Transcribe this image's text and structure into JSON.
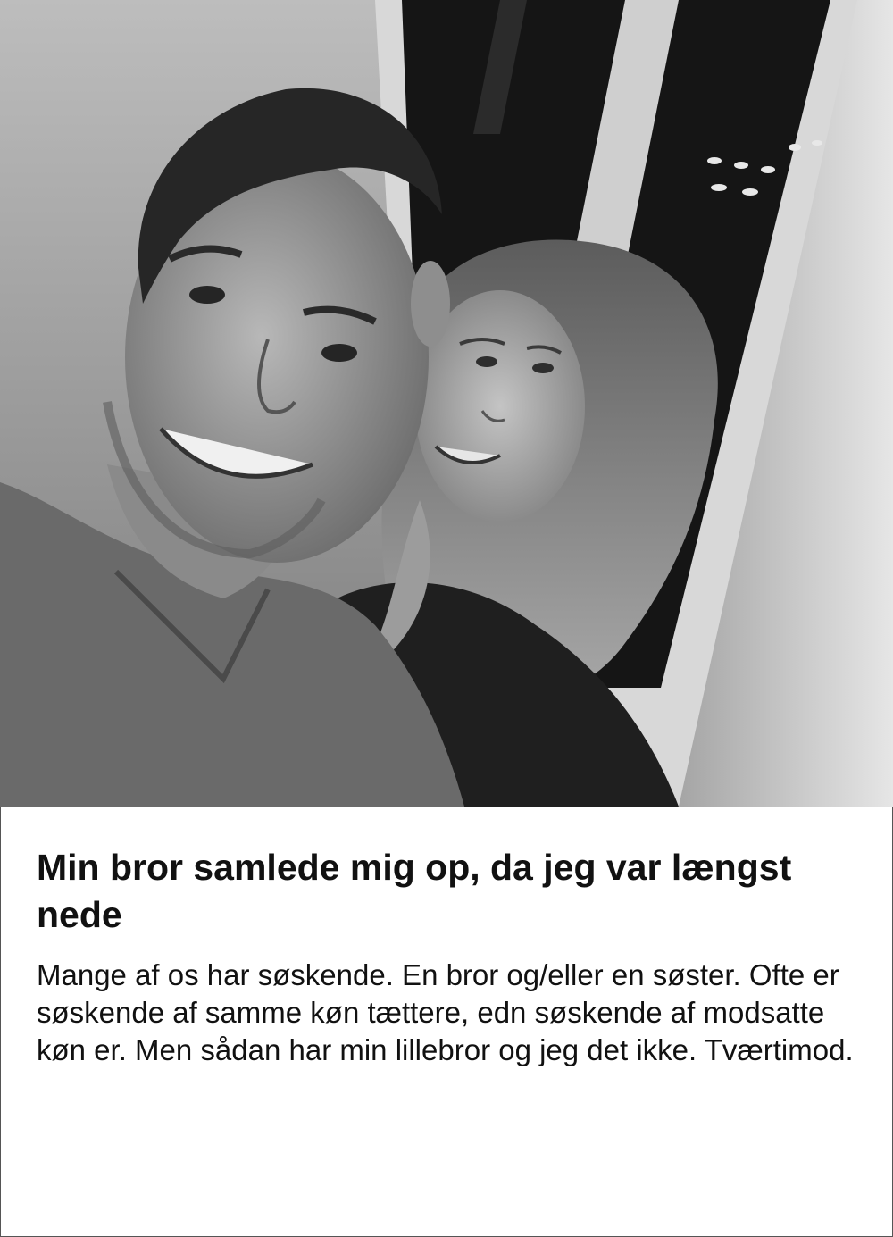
{
  "article": {
    "headline": "Min bror samlede mig op, da jeg var længst nede",
    "body": "Mange af os har søskende. En bror og/eller en søster. Ofte er søskende af samme køn tættere, edn søskende af modsatte køn er. Men sådan har min lillebror og jeg det ikke. Tværtimod."
  },
  "photo": {
    "style": "black-and-white",
    "colors": {
      "background_wall": "#cfcfcf",
      "window_dark": "#141414",
      "skin": "#9a9a9a",
      "hair_dark": "#2a2a2a",
      "hair_light": "#b5b5b5",
      "shirt": "#6e6e6e"
    }
  }
}
